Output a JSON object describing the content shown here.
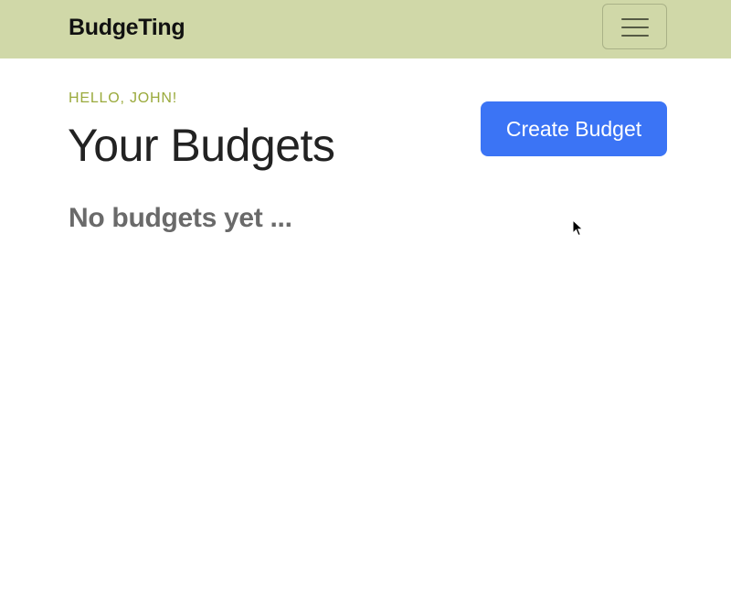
{
  "navbar": {
    "brand": "BudgeTing",
    "menu_icon": "hamburger-menu-icon",
    "background_color": "#d0d8a8"
  },
  "main": {
    "greeting": "HELLO, JOHN!",
    "title": "Your Budgets",
    "create_button_label": "Create Budget",
    "empty_message": "No budgets yet ...",
    "accent_color": "#3b74f5",
    "greeting_color": "#9aaa3c"
  }
}
